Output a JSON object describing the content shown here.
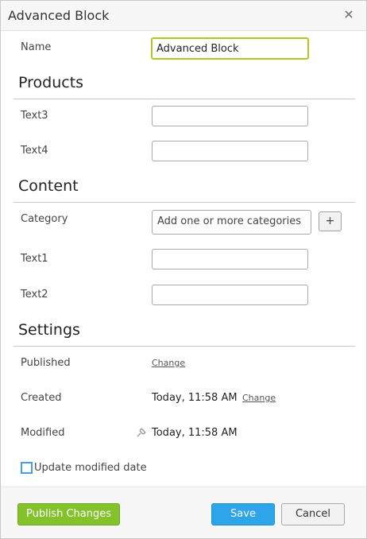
{
  "dialog": {
    "title": "Advanced Block"
  },
  "name_field": {
    "label": "Name",
    "value": "Advanced Block"
  },
  "products": {
    "heading": "Products",
    "text3": {
      "label": "Text3",
      "value": ""
    },
    "text4": {
      "label": "Text4",
      "value": ""
    }
  },
  "content": {
    "heading": "Content",
    "category": {
      "label": "Category",
      "placeholder": "Add one or more categories",
      "add_label": "+"
    },
    "text1": {
      "label": "Text1",
      "value": ""
    },
    "text2": {
      "label": "Text2",
      "value": ""
    }
  },
  "settings": {
    "heading": "Settings",
    "published": {
      "label": "Published",
      "change_label": "Change"
    },
    "created": {
      "label": "Created",
      "value": "Today, 11:58 AM",
      "change_label": "Change"
    },
    "modified": {
      "label": "Modified",
      "value": "Today, 11:58 AM",
      "icon": "pin-icon"
    },
    "update_modified": {
      "label": "Update modified date",
      "checked": false
    }
  },
  "footer": {
    "publish_label": "Publish Changes",
    "save_label": "Save",
    "cancel_label": "Cancel"
  },
  "colors": {
    "focus_border": "#b5c51f",
    "publish_green": "#83c22b",
    "save_blue": "#2ea5eb",
    "checkbox_blue": "#4a9fe0"
  }
}
